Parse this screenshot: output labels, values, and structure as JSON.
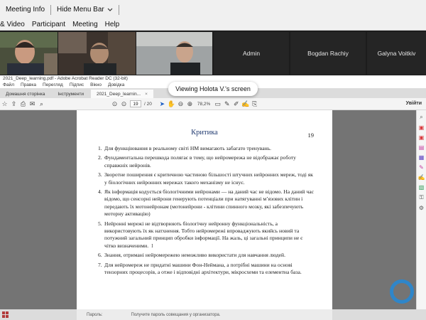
{
  "zoom": {
    "top_bar": {
      "meeting_info": "Meeting Info",
      "hide_menu_bar": "Hide Menu Bar",
      "hide_menu_chevron": "chevron-down-icon"
    },
    "menu": [
      "& Video",
      "Participant",
      "Meeting",
      "Help"
    ],
    "participants": [
      {
        "type": "video",
        "label": ""
      },
      {
        "type": "video",
        "label": ""
      },
      {
        "type": "video",
        "label": ""
      },
      {
        "type": "name",
        "label": "Admin"
      },
      {
        "type": "name",
        "label": "Bogdan Rachiy"
      },
      {
        "type": "name",
        "label": "Galyna Voitkiv"
      }
    ],
    "viewing_banner": "Viewing Holota V.'s screen"
  },
  "acrobat": {
    "title": "2021_Deep_learning.pdf - Adobe Acrobat Reader DC (32-bit)",
    "menu": [
      "Файл",
      "Правка",
      "Перегляд",
      "Підпис",
      "Вікно",
      "Довідка"
    ],
    "tabs": [
      "Домашня сторінка",
      "Інструменти",
      "2021_Deep_learnin..."
    ],
    "toolbar": {
      "page_current": "19",
      "page_total": "/ 20",
      "zoom": "78,2%"
    },
    "sign_in": "Увійти",
    "page": {
      "title": "Критика",
      "number": "19",
      "items": [
        {
          "n": "1.",
          "text": "Для функціювання в реальному світі НМ вимагають забагато тренувань."
        },
        {
          "n": "2.",
          "text": "Фундаментальна перешкода полягає в тому, що нейромережа не відображає роботу справжніх нейронів."
        },
        {
          "n": "3.",
          "text": "Зворотне поширення є критичною частиною більшості штучних нейронних мереж, тоді як у біологічних нейронних мережах такого механізму не існує."
        },
        {
          "n": "4.",
          "text": "Як інформація кодується біологічними нейронами — на даний час не відомо. На даний час відомо, що сенсорні нейрони генерують потенціали при натягуванні м’язових клітин і передають їх мотонейронам (мотонейрони - клітини спинного мозку, які забезпечують моторну активацію)"
        },
        {
          "n": "5.",
          "text": "Нейронні мережі не відтворюють біологічну нейронну функціональність, а використовують їх як натхнення. Тобто нейромережі впроваджують якийсь новий та потужний загальний принцип обробки інформації. На жаль, ці загальні принципи не є чітко визначеними."
        },
        {
          "n": "6.",
          "text": "Знання, отримані нейромережею неможливо використати для навчання людей."
        },
        {
          "n": "7.",
          "text": "Для нейромереж не придатні машини Фон-Неймана, а потрібні машини на основі тензорних процесорів, а отже і відповідні архітектури, мікросхеми та елементна база."
        }
      ]
    },
    "bottom": {
      "password_label": "Пароль:",
      "password_hint": "Получите пароль совещания у организатора."
    }
  },
  "colors": {
    "zoom_bar": "#f0f0f0",
    "strip_bg": "#1c1c1c",
    "doc_bg": "#747474",
    "title_blue": "#203a70",
    "zoom_logo": "#2f86c9"
  }
}
